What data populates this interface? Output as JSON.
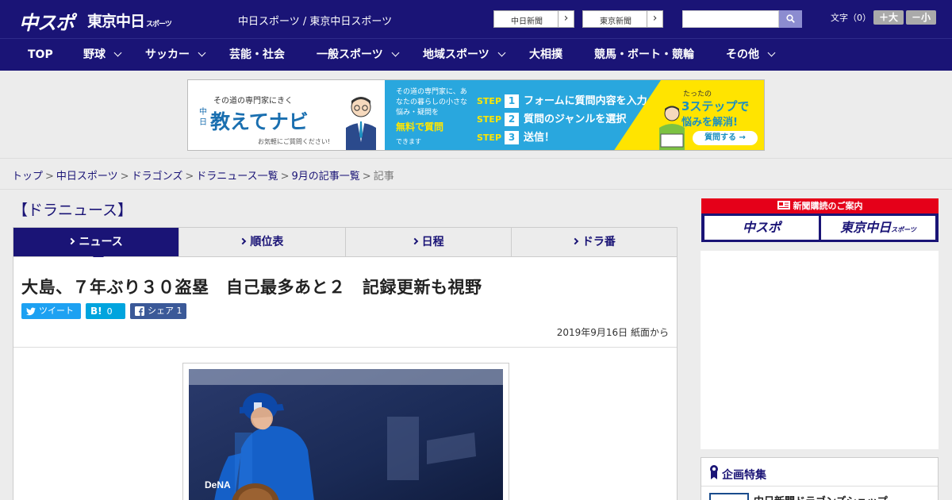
{
  "header": {
    "logo_chuspo": "中スポ",
    "logo_tokyo": "東京中日",
    "logo_tokyo_small": "スポーツ",
    "site_title": "中日スポーツ / 東京中日スポーツ",
    "chunichi_button": "中日新聞",
    "tokyo_button": "東京新聞",
    "search_placeholder": "",
    "font_label": "文字（0）",
    "font_bigger": "＋大",
    "font_smaller": "－小"
  },
  "nav": {
    "items": [
      {
        "label": "TOP",
        "dropdown": false
      },
      {
        "label": "野球",
        "dropdown": true
      },
      {
        "label": "サッカー",
        "dropdown": true
      },
      {
        "label": "芸能・社会",
        "dropdown": false
      },
      {
        "label": "一般スポーツ",
        "dropdown": true
      },
      {
        "label": "地域スポーツ",
        "dropdown": true
      },
      {
        "label": "大相撲",
        "dropdown": false
      },
      {
        "label": "競馬・ボート・競輪",
        "dropdown": false
      },
      {
        "label": "その他",
        "dropdown": true
      }
    ]
  },
  "banner": {
    "left_line1": "その道の専門家にきく",
    "left_prefix": "中日",
    "left_line2": "教えてナビ",
    "left_line3": "お気軽にご質問ください!",
    "mid_text": "その道の専門家に、あなたの暮らしの小さな悩み・疑問を",
    "mid_highlight": "無料で質問",
    "mid_tail": "できます",
    "step_label": "STEP",
    "steps": [
      {
        "num": "1",
        "text": "フォームに質問内容を入力"
      },
      {
        "num": "2",
        "text": "質問のジャンルを選択"
      },
      {
        "num": "3",
        "text": "送信！"
      }
    ],
    "right_line1": "たったの",
    "right_line2": "3ステップで",
    "right_line3": "悩みを解消!",
    "right_button": "質問する →"
  },
  "breadcrumb": {
    "items": [
      "トップ",
      "中日スポーツ",
      "ドラゴンズ",
      "ドラニュース一覧",
      "9月の記事一覧"
    ],
    "current": "記事",
    "separator": ">"
  },
  "main": {
    "section_title": "【ドラニュース】",
    "tabs": [
      {
        "label": "ニュース",
        "active": true
      },
      {
        "label": "順位表",
        "active": false
      },
      {
        "label": "日程",
        "active": false
      },
      {
        "label": "ドラ番",
        "active": false
      }
    ],
    "headline": "大島、７年ぶり３０盗塁　自己最多あと２　記録更新も視野",
    "share": {
      "tweet": "ツイート",
      "hatena": "0",
      "facebook": "シェア 1"
    },
    "pubdate": "2019年9月16日 紙面から"
  },
  "sidebar": {
    "subscribe_head": "新聞購読のご案内",
    "subscribe_chuspo": "中スポ",
    "subscribe_tokyo": "東京中日",
    "subscribe_tokyo_small": "スポーツ",
    "feature_title": "企画特集",
    "feature_item": "中日新聞ドラゴンズショップ"
  },
  "colors": {
    "brand_navy": "#1a1476",
    "accent_red": "#e50019",
    "twitter": "#1da1f2",
    "hatena": "#00a4de",
    "facebook": "#3b5998"
  }
}
